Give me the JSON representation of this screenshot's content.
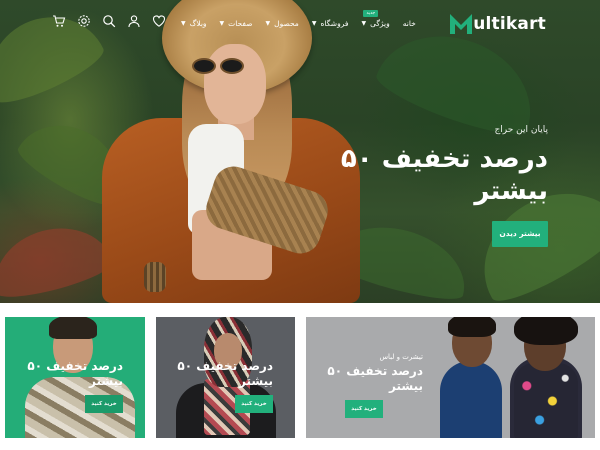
{
  "header": {
    "logo_text": "ultikart",
    "logo_color": "#22b07c",
    "nav": [
      {
        "label": "خانه",
        "chevron": false,
        "badge": ""
      },
      {
        "label": "ویژگی",
        "chevron": true,
        "badge": "جدید"
      },
      {
        "label": "فروشگاه",
        "chevron": true,
        "badge": ""
      },
      {
        "label": "محصول",
        "chevron": true,
        "badge": ""
      },
      {
        "label": "صفحات",
        "chevron": true,
        "badge": ""
      },
      {
        "label": "وبلاگ",
        "chevron": true,
        "badge": ""
      }
    ],
    "icons": [
      "heart-icon",
      "user-icon",
      "search-icon",
      "settings-icon",
      "cart-icon"
    ]
  },
  "hero": {
    "subtitle": "پایان این حراج",
    "title": "۵۰ درصد تخفیف بیشتر",
    "button": "بیشتر دیدن"
  },
  "banners": [
    {
      "subtitle": "",
      "title": "۵۰ درصد تخفیف بیشتر",
      "button": "خرید کنید"
    },
    {
      "subtitle": "",
      "title": "۵۰ درصد تخفیف بیشتر",
      "button": "خرید کنید"
    },
    {
      "subtitle": "تیشرت و لباس",
      "title": "۵۰ درصد تخفیف بیشتر",
      "button": "خرید کنید"
    }
  ],
  "colors": {
    "accent": "#22b07c",
    "banner_green": "#24ad78",
    "banner_dark": "#5b5e63",
    "banner_gray": "#a9aaac"
  }
}
